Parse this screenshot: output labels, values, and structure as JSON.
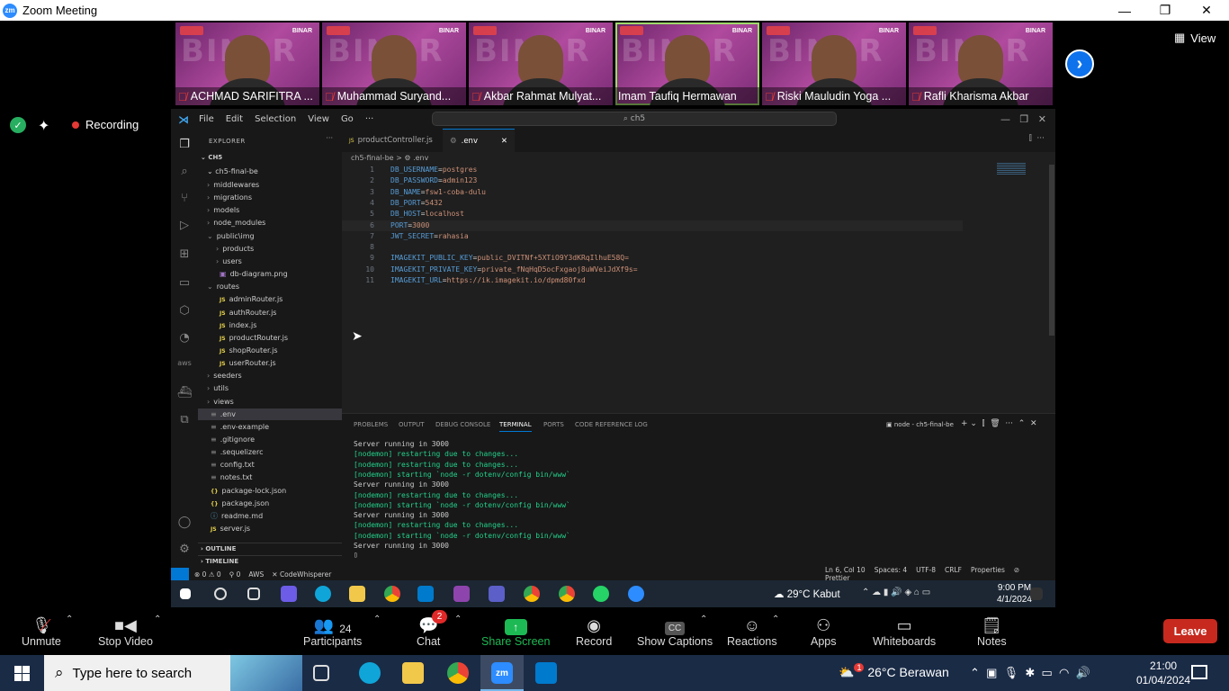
{
  "window": {
    "title": "Zoom Meeting",
    "logo": "zm",
    "controls": {
      "minimize": "—",
      "restore": "❐",
      "close": "✕"
    }
  },
  "participants": [
    {
      "name": "ACHMAD SARIFITRA ...",
      "muted": true
    },
    {
      "name": "Muhammad Suryand...",
      "muted": true
    },
    {
      "name": "Akbar Rahmat Mulyat...",
      "muted": true
    },
    {
      "name": "Imam Taufiq Hermawan",
      "muted": false,
      "active": true
    },
    {
      "name": "Riski Mauludin Yoga ...",
      "muted": true
    },
    {
      "name": "Rafli Kharisma Akbar",
      "muted": true
    }
  ],
  "tile_brand": "BINAR",
  "view_label": "View",
  "recording_label": "Recording",
  "vscode": {
    "menus": [
      "File",
      "Edit",
      "Selection",
      "View",
      "Go",
      "···"
    ],
    "search": "ch5",
    "explorer_title": "EXPLORER",
    "root": "CH5",
    "project": "ch5-final-be",
    "tree": [
      {
        "label": "middlewares",
        "type": "folder",
        "indent": 1
      },
      {
        "label": "migrations",
        "type": "folder",
        "indent": 1
      },
      {
        "label": "models",
        "type": "folder",
        "indent": 1
      },
      {
        "label": "node_modules",
        "type": "folder",
        "indent": 1
      },
      {
        "label": "public\\img",
        "type": "folder-open",
        "indent": 1
      },
      {
        "label": "products",
        "type": "folder",
        "indent": 2
      },
      {
        "label": "users",
        "type": "folder",
        "indent": 2
      },
      {
        "label": "db-diagram.png",
        "type": "img",
        "indent": 2
      },
      {
        "label": "routes",
        "type": "folder-open",
        "indent": 1
      },
      {
        "label": "adminRouter.js",
        "type": "js",
        "indent": 2
      },
      {
        "label": "authRouter.js",
        "type": "js",
        "indent": 2
      },
      {
        "label": "index.js",
        "type": "js",
        "indent": 2
      },
      {
        "label": "productRouter.js",
        "type": "js",
        "indent": 2
      },
      {
        "label": "shopRouter.js",
        "type": "js",
        "indent": 2
      },
      {
        "label": "userRouter.js",
        "type": "js",
        "indent": 2
      },
      {
        "label": "seeders",
        "type": "folder",
        "indent": 1
      },
      {
        "label": "utils",
        "type": "folder",
        "indent": 1
      },
      {
        "label": "views",
        "type": "folder",
        "indent": 1
      },
      {
        "label": ".env",
        "type": "cfg",
        "indent": 1,
        "selected": true
      },
      {
        "label": ".env-example",
        "type": "cfg",
        "indent": 1
      },
      {
        "label": ".gitignore",
        "type": "cfg",
        "indent": 1
      },
      {
        "label": ".sequelizerc",
        "type": "cfg",
        "indent": 1
      },
      {
        "label": "config.txt",
        "type": "cfg",
        "indent": 1
      },
      {
        "label": "notes.txt",
        "type": "cfg",
        "indent": 1
      },
      {
        "label": "package-lock.json",
        "type": "json",
        "indent": 1
      },
      {
        "label": "package.json",
        "type": "json",
        "indent": 1
      },
      {
        "label": "readme.md",
        "type": "md",
        "indent": 1
      },
      {
        "label": "server.js",
        "type": "js",
        "indent": 1
      }
    ],
    "outline": "OUTLINE",
    "timeline": "TIMELINE",
    "tabs": [
      {
        "label": "productController.js"
      },
      {
        "label": ".env",
        "active": true
      }
    ],
    "breadcrumb": "ch5-final-be  >  ⚙ .env",
    "code": [
      {
        "n": "1",
        "key": "DB_USERNAME",
        "val": "postgres"
      },
      {
        "n": "2",
        "key": "DB_PASSWORD",
        "val": "admin123"
      },
      {
        "n": "3",
        "key": "DB_NAME",
        "val": "fsw1-coba-dulu"
      },
      {
        "n": "4",
        "key": "DB_PORT",
        "val": "5432"
      },
      {
        "n": "5",
        "key": "DB_HOST",
        "val": "localhost"
      },
      {
        "n": "6",
        "key": "PORT",
        "val": "3000"
      },
      {
        "n": "7",
        "key": "JWT_SECRET",
        "val": "rahasia"
      },
      {
        "n": "8",
        "key": "",
        "val": ""
      },
      {
        "n": "9",
        "key": "IMAGEKIT_PUBLIC_KEY",
        "val": "public_DVITNf+5XTiO9Y3dKRqIlhuE58Q="
      },
      {
        "n": "10",
        "key": "IMAGEKIT_PRIVATE_KEY",
        "val": "private_fNqHqD5ocFxgaoj8uWVeiJdXf9s="
      },
      {
        "n": "11",
        "key": "IMAGEKIT_URL",
        "val": "https://ik.imagekit.io/dpmd80fxd"
      }
    ],
    "panel_tabs": [
      "PROBLEMS",
      "OUTPUT",
      "DEBUG CONSOLE",
      "TERMINAL",
      "PORTS",
      "CODE REFERENCE LOG"
    ],
    "terminal_name": "node - ch5-final-be",
    "terminal": [
      {
        "t": "Server running in 3000",
        "c": "w"
      },
      {
        "t": "[nodemon] restarting due to changes...",
        "c": "g"
      },
      {
        "t": "[nodemon] restarting due to changes...",
        "c": "g"
      },
      {
        "t": "[nodemon] starting `node -r dotenv/config bin/www`",
        "c": "g"
      },
      {
        "t": "Server running in 3000",
        "c": "w"
      },
      {
        "t": "[nodemon] restarting due to changes...",
        "c": "g"
      },
      {
        "t": "[nodemon] starting `node -r dotenv/config bin/www`",
        "c": "g"
      },
      {
        "t": "Server running in 3000",
        "c": "w"
      },
      {
        "t": "[nodemon] restarting due to changes...",
        "c": "g"
      },
      {
        "t": "[nodemon] starting `node -r dotenv/config bin/www`",
        "c": "g"
      },
      {
        "t": "Server running in 3000",
        "c": "w"
      }
    ],
    "status_left": [
      "⊗ 0 ⚠ 0",
      "⚲ 0",
      "AWS",
      "✕ CodeWhisperer"
    ],
    "status_right": [
      "Ln 6, Col 10",
      "Spaces: 4",
      "UTF-8",
      "CRLF",
      "Properties",
      "⊘ Prettier"
    ]
  },
  "inner_taskbar": {
    "weather": "29°C  Kabut",
    "time": "9:00 PM",
    "date": "4/1/2024"
  },
  "toolbar": {
    "unmute": "Unmute",
    "stop_video": "Stop Video",
    "participants": "Participants",
    "participants_count": "24",
    "chat": "Chat",
    "chat_badge": "2",
    "share": "Share Screen",
    "record": "Record",
    "captions": "Show Captions",
    "reactions": "Reactions",
    "apps": "Apps",
    "whiteboards": "Whiteboards",
    "notes": "Notes",
    "leave": "Leave"
  },
  "taskbar": {
    "search_placeholder": "Type here to search",
    "weather": "26°C  Berawan",
    "weather_badge": "1",
    "time": "21:00",
    "date": "01/04/2024"
  }
}
